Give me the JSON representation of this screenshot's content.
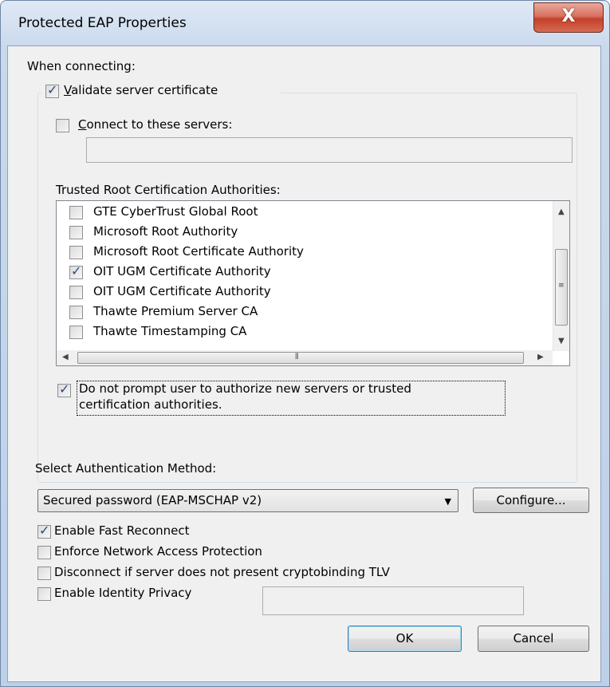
{
  "window": {
    "title": "Protected EAP Properties",
    "close_label": "X"
  },
  "connecting": {
    "heading_text": "When connecting:",
    "validate_cert": {
      "label_text": "Validate server certificate",
      "checked": true
    },
    "connect_servers": {
      "label_text": "Connect to these servers:",
      "checked": false,
      "value": ""
    },
    "trusted_heading_text": "Trusted Root Certification Authorities:",
    "authorities": [
      {
        "label": "GTE CyberTrust Global Root",
        "checked": false
      },
      {
        "label": "Microsoft Root Authority",
        "checked": false
      },
      {
        "label": "Microsoft Root Certificate Authority",
        "checked": false
      },
      {
        "label": "OIT UGM Certificate Authority",
        "checked": true
      },
      {
        "label": "OIT UGM Certificate Authority",
        "checked": false
      },
      {
        "label": "Thawte Premium Server CA",
        "checked": false
      },
      {
        "label": "Thawte Timestamping CA",
        "checked": false
      }
    ],
    "no_prompt": {
      "line1": "Do not prompt user to authorize new servers or trusted",
      "line2": "certification authorities.",
      "checked": true
    }
  },
  "auth": {
    "heading_text": "Select Authentication Method:",
    "method_value": "Secured password (EAP-MSCHAP v2)",
    "configure_label": "Configure..."
  },
  "options": {
    "fast_reconnect": {
      "label_text": "Enable Fast Reconnect",
      "checked": true
    },
    "nap": {
      "label_text": "Enforce Network Access Protection",
      "checked": false
    },
    "cryptobinding": {
      "label_text": "Disconnect if server does not present cryptobinding TLV",
      "checked": false
    },
    "identity_privacy": {
      "label_text": "Enable Identity Privacy",
      "checked": false,
      "value": ""
    }
  },
  "buttons": {
    "ok": "OK",
    "cancel": "Cancel"
  },
  "colors": {
    "accent_close": "#c2412b",
    "frame": "#bcd0e8",
    "client_bg": "#f0f0f0"
  }
}
